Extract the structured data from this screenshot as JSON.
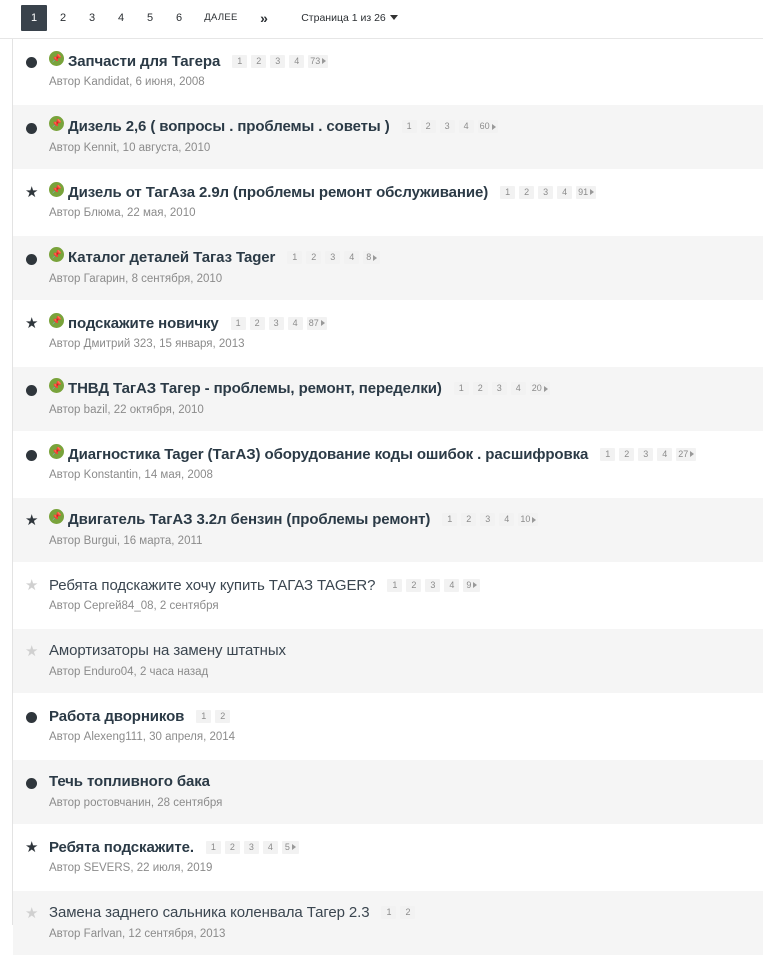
{
  "pagination": {
    "pages": [
      "1",
      "2",
      "3",
      "4",
      "5",
      "6"
    ],
    "active": "1",
    "next_label": "ДАЛЕЕ",
    "last_label": "»",
    "page_info": "Страница 1 из 26"
  },
  "topics": [
    {
      "status": "dot",
      "pinned": true,
      "title": "Запчасти для Тагера",
      "pages": [
        "1",
        "2",
        "3",
        "4",
        "73"
      ],
      "meta_prefix": "Автор",
      "author": "Kandidat",
      "date": "6 июня, 2008",
      "bold": true
    },
    {
      "status": "dot",
      "pinned": true,
      "title": "Дизель 2,6 ( вопросы . проблемы . советы )",
      "pages": [
        "1",
        "2",
        "3",
        "4",
        "60"
      ],
      "meta_prefix": "Автор",
      "author": "Kennit",
      "date": "10 августа, 2010",
      "bold": true
    },
    {
      "status": "star",
      "pinned": true,
      "title": "Дизель от ТагАза 2.9л (проблемы ремонт обслуживание)",
      "pages": [
        "1",
        "2",
        "3",
        "4",
        "91"
      ],
      "meta_prefix": "Автор",
      "author": "Блюма",
      "date": "22 мая, 2010",
      "bold": true
    },
    {
      "status": "dot",
      "pinned": true,
      "title": "Каталог деталей Тагаз Tager",
      "pages": [
        "1",
        "2",
        "3",
        "4",
        "8"
      ],
      "meta_prefix": "Автор",
      "author": "Гагарин",
      "date": "8 сентября, 2010",
      "bold": true
    },
    {
      "status": "star",
      "pinned": true,
      "title": "подскажите новичку",
      "pages": [
        "1",
        "2",
        "3",
        "4",
        "87"
      ],
      "meta_prefix": "Автор",
      "author": "Дмитрий 323",
      "date": "15 января, 2013",
      "bold": true
    },
    {
      "status": "dot",
      "pinned": true,
      "title": "ТНВД ТагАЗ Тагер - проблемы, ремонт, переделки)",
      "pages": [
        "1",
        "2",
        "3",
        "4",
        "20"
      ],
      "meta_prefix": "Автор",
      "author": "bazil",
      "date": "22 октября, 2010",
      "bold": true
    },
    {
      "status": "dot",
      "pinned": true,
      "title": "Диагностика Tager (ТагАЗ) оборудование коды ошибок . расшифровка",
      "pages": [
        "1",
        "2",
        "3",
        "4",
        "27"
      ],
      "meta_prefix": "Автор",
      "author": "Konstantin",
      "date": "14 мая, 2008",
      "bold": true
    },
    {
      "status": "star",
      "pinned": true,
      "title": "Двигатель ТагАЗ 3.2л бензин (проблемы ремонт)",
      "pages": [
        "1",
        "2",
        "3",
        "4",
        "10"
      ],
      "meta_prefix": "Автор",
      "author": "Burgui",
      "date": "16 марта, 2011",
      "bold": true
    },
    {
      "status": "star-empty",
      "pinned": false,
      "title": "Ребята подскажите хочу купить ТАГАЗ TAGER?",
      "pages": [
        "1",
        "2",
        "3",
        "4",
        "9"
      ],
      "meta_prefix": "Автор",
      "author": "Сергей84_08",
      "date": "2 сентября",
      "bold": false
    },
    {
      "status": "star-empty",
      "pinned": false,
      "title": "Амортизаторы на замену штатных",
      "pages": [],
      "meta_prefix": "Автор",
      "author": "Enduro04",
      "date": "2 часа назад",
      "bold": false
    },
    {
      "status": "dot",
      "pinned": false,
      "title": "Работа дворников",
      "pages": [
        "1",
        "2"
      ],
      "meta_prefix": "Автор",
      "author": "Alexeng111",
      "date": "30 апреля, 2014",
      "bold": true
    },
    {
      "status": "dot",
      "pinned": false,
      "title": "Течь топливного бака",
      "pages": [],
      "meta_prefix": "Автор",
      "author": "ростовчанин",
      "date": "28 сентября",
      "bold": true
    },
    {
      "status": "star",
      "pinned": false,
      "title": "Ребята подскажите.",
      "pages": [
        "1",
        "2",
        "3",
        "4",
        "5"
      ],
      "meta_prefix": "Автор",
      "author": "SEVERS",
      "date": "22 июля, 2019",
      "bold": true
    },
    {
      "status": "star-empty",
      "pinned": false,
      "title": "Замена заднего сальника коленвала Тагер 2.3",
      "pages": [
        "1",
        "2"
      ],
      "meta_prefix": "Автор",
      "author": "Farlvan",
      "date": "12 сентября, 2013",
      "bold": false
    }
  ],
  "icons": {
    "status_dot": "unread-dot-icon",
    "status_star": "star-icon",
    "pin": "pin-icon",
    "caret": "caret-down-icon"
  },
  "colors": {
    "active_page_bg": "#39424b",
    "pin_green": "#79a33b",
    "title": "#2b3a46",
    "meta": "#8b8b8b",
    "alt_row": "#f5f5f5"
  }
}
